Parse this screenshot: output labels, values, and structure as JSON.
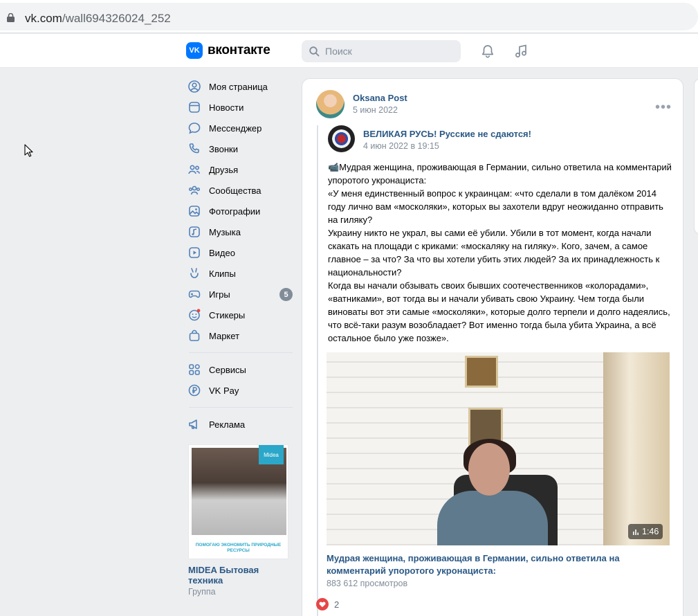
{
  "browser": {
    "url_host": "vk.com",
    "url_path": "/wall694326024_252"
  },
  "header": {
    "logo_mark": "VK",
    "logo_text": "вконтакте",
    "search_placeholder": "Поиск"
  },
  "menu": {
    "items": [
      {
        "label": "Моя страница",
        "icon": "profile-icon"
      },
      {
        "label": "Новости",
        "icon": "news-icon"
      },
      {
        "label": "Мессенджер",
        "icon": "messenger-icon"
      },
      {
        "label": "Звонки",
        "icon": "phone-icon"
      },
      {
        "label": "Друзья",
        "icon": "friends-icon"
      },
      {
        "label": "Сообщества",
        "icon": "communities-icon"
      },
      {
        "label": "Фотографии",
        "icon": "photos-icon"
      },
      {
        "label": "Музыка",
        "icon": "music-icon"
      },
      {
        "label": "Видео",
        "icon": "video-icon"
      },
      {
        "label": "Клипы",
        "icon": "clips-icon"
      },
      {
        "label": "Игры",
        "icon": "games-icon",
        "badge": "5"
      },
      {
        "label": "Стикеры",
        "icon": "stickers-icon"
      },
      {
        "label": "Маркет",
        "icon": "market-icon"
      }
    ],
    "services": [
      {
        "label": "Сервисы",
        "icon": "services-icon"
      },
      {
        "label": "VK Pay",
        "icon": "vkpay-icon"
      }
    ],
    "ads": {
      "label": "Реклама",
      "icon": "megaphone-icon"
    }
  },
  "ad": {
    "brand": "Midea",
    "caption": "ПОМОГАЮ ЭКОНОМИТЬ ПРИРОДНЫЕ РЕСУРСЫ",
    "title": "MIDEA Бытовая техника",
    "subtitle": "Группа"
  },
  "post": {
    "author": "Oksana Post",
    "date": "5 июн 2022",
    "repost": {
      "group_name": "ВЕЛИКАЯ РУСЬ! Русские не сдаются!",
      "date": "4 июн 2022 в 19:15",
      "paragraphs": [
        "📹Мудрая женщина, проживающая в Германии, сильно ответила на комментарий упоротого укронациста:",
        "«У меня единственный вопрос к украинцам: «что сделали в том далёком 2014 году лично вам «москоляки», которых вы захотели вдруг неожиданно отправить на гиляку?",
        "Украину никто не украл, вы сами её убили. Убили в тот момент, когда начали скакать на площади с криками: «москаляку на гиляку». Кого, зачем, а самое главное – за что? За что вы хотели убить этих людей? За их принадлежность к национальности?",
        "Когда вы начали обзывать своих бывших соотечественников «колорадами», «ватниками», вот тогда вы и начали убивать свою Украину. Чем тогда были виноваты вот эти самые «москоляки», которые долго терпели и долго надеялись, что всё-таки разум возобладает? Вот именно тогда была убита Украина, а всё остальное было уже позже»."
      ]
    },
    "video": {
      "duration": "1:46",
      "title": "Мудрая женщина, проживающая в Германии, сильно ответила на комментарий упоротого укронациста:",
      "views": "883 612 просмотров"
    },
    "likes": "2",
    "colors": {
      "link": "#2a5885",
      "like": "#e64646",
      "accent": "#0077ff"
    }
  }
}
